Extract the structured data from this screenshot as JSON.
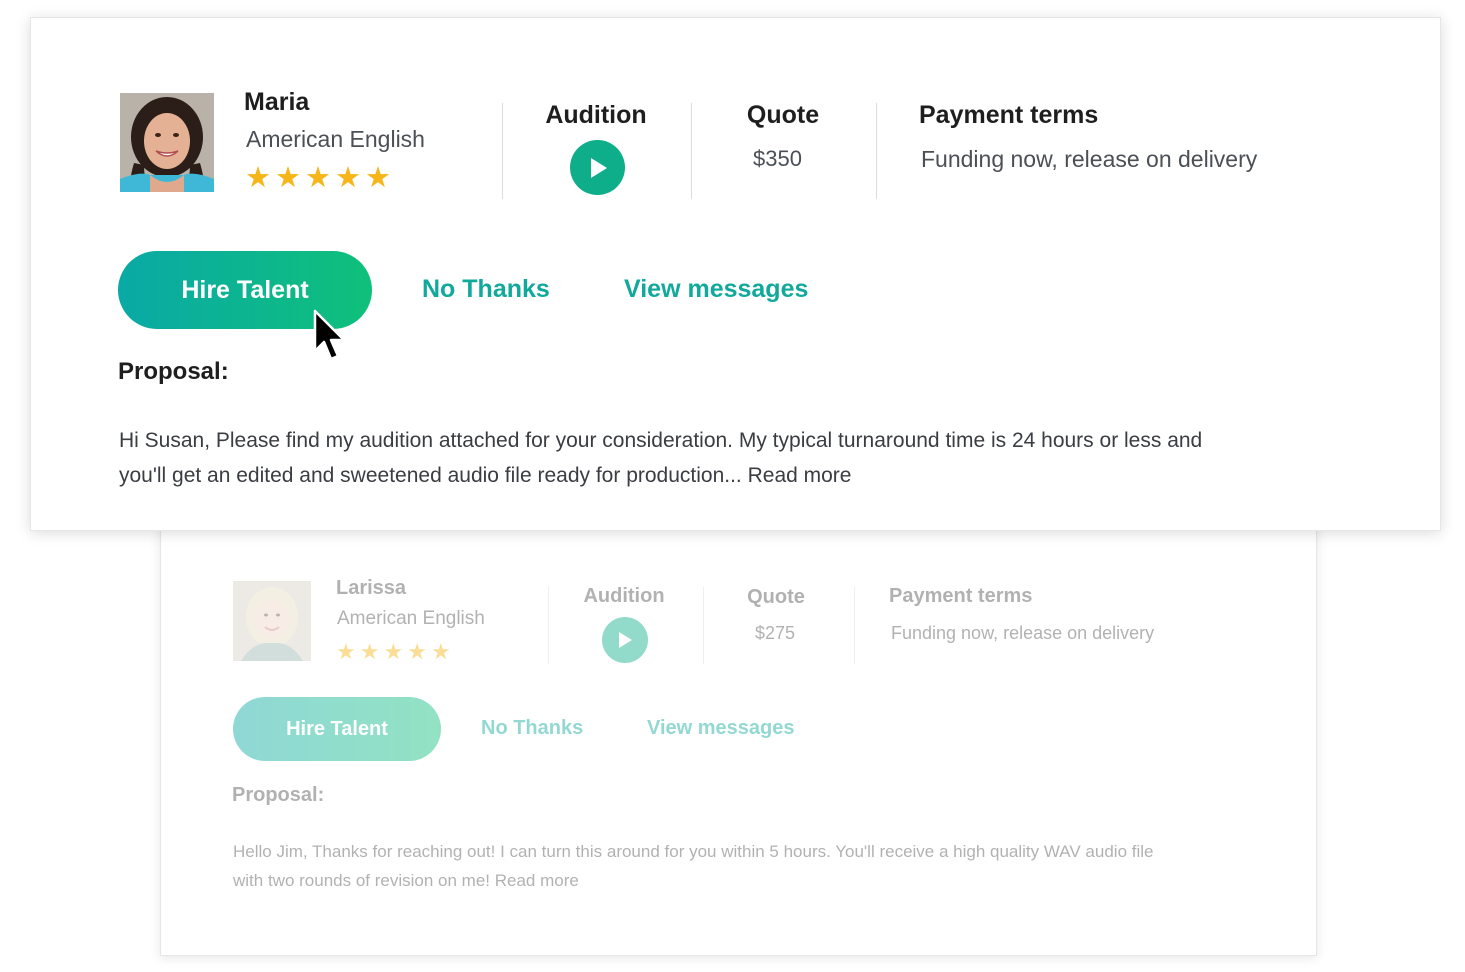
{
  "colors": {
    "accent": "#0fae8a",
    "link": "#11a99c",
    "star": "#f6b619",
    "hire_gradient_start": "#0aa9a6",
    "hire_gradient_end": "#0fc07a"
  },
  "icons": [
    "star-icon",
    "play-icon",
    "mouse-pointer-icon"
  ],
  "proposals": [
    {
      "name": "Maria",
      "language": "American English",
      "rating": 5,
      "stars": [
        "★",
        "★",
        "★",
        "★",
        "★"
      ],
      "audition_label": "Audition",
      "quote_label": "Quote",
      "quote_value": "$350",
      "payment_label": "Payment terms",
      "payment_value": "Funding now, release on delivery",
      "hire_label": "Hire Talent",
      "decline_label": "No Thanks",
      "messages_label": "View messages",
      "proposal_label": "Proposal:",
      "proposal_line1": "Hi Susan, Please find my audition attached for your consideration. My typical turnaround time is 24 hours or less and",
      "proposal_line2": "you'll get an edited and sweetened audio file ready for production... Read more"
    },
    {
      "name": "Larissa",
      "language": "American English",
      "rating": 5,
      "stars": [
        "★",
        "★",
        "★",
        "★",
        "★"
      ],
      "audition_label": "Audition",
      "quote_label": "Quote",
      "quote_value": "$275",
      "payment_label": "Payment terms",
      "payment_value": "Funding now, release on delivery",
      "hire_label": "Hire Talent",
      "decline_label": "No Thanks",
      "messages_label": "View messages",
      "proposal_label": "Proposal:",
      "proposal_line1": "Hello Jim, Thanks for reaching out! I can turn this around for you within 5 hours. You'll receive a high quality WAV audio file",
      "proposal_line2": "with two rounds of revision on me! Read more"
    }
  ]
}
